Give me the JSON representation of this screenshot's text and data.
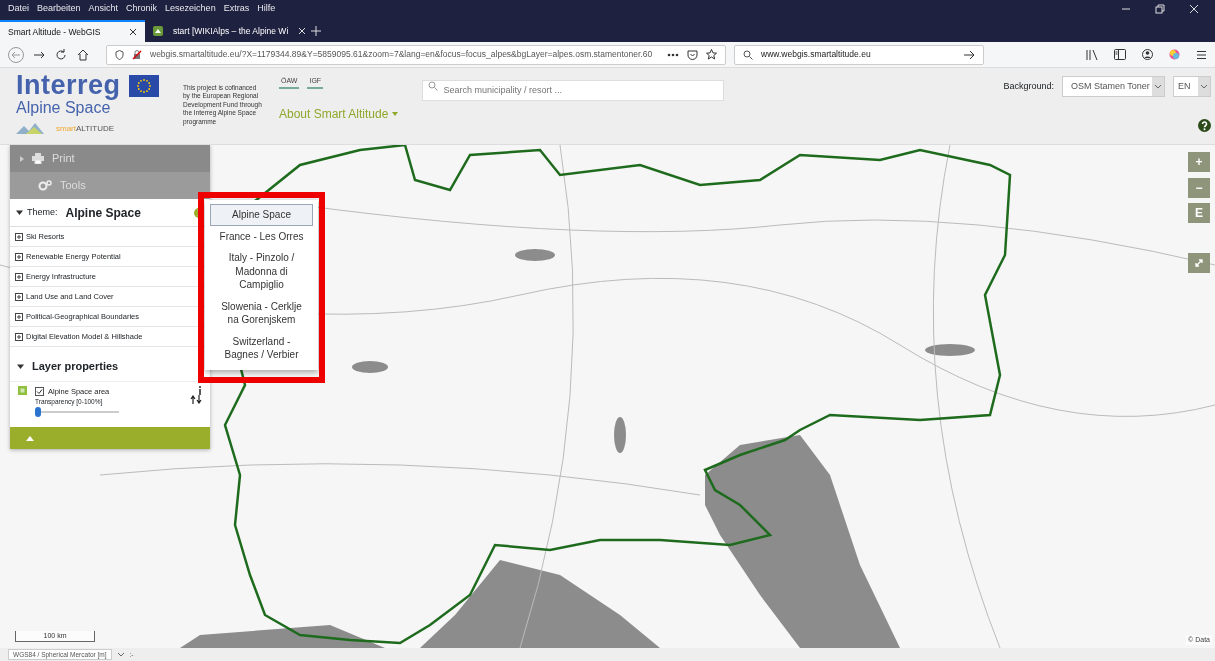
{
  "browser": {
    "menu": [
      "Datei",
      "Bearbeiten",
      "Ansicht",
      "Chronik",
      "Lesezeichen",
      "Extras",
      "Hilfe"
    ],
    "tabs": [
      {
        "label": "Smart Altitude - WebGIS",
        "selected": true
      },
      {
        "label": "start [WIKIAlps – the Alpine Wi",
        "selected": false
      }
    ],
    "url": "webgis.smartaltitude.eu/?X=1179344.89&Y=5859095.61&zoom=7&lang=en&focus=focus_alpes&bgLayer=alpes.osm.stamentoner.60",
    "search_value": "www.webgis.smartaltitude.eu"
  },
  "header": {
    "logo_title": "Interreg",
    "logo_subtitle": "Alpine Space",
    "brand_prefix": "smart",
    "brand_suffix": "ALTITUDE",
    "funding_note": "This project is cofinanced by the European Regional Development Fund through the Interreg Alpine Space programme",
    "partner_logos": [
      "ÖAW",
      "IGF"
    ],
    "about_menu": "About Smart Altitude",
    "search": {
      "placeholder": "Search municipality / resort ..."
    },
    "background_label": "Background:",
    "background_value": "OSM Stamen Toner",
    "language": "EN"
  },
  "sidebar": {
    "panels": [
      "Print",
      "Tools"
    ],
    "theme": {
      "label": "Theme:",
      "name": "Alpine Space",
      "expanded": true
    },
    "layer_groups": [
      "Ski Resorts",
      "Renewable Energy Potential",
      "Energy Infrastructure",
      "Land Use and Land Cover",
      "Political-Geographical Boundaries",
      "Digital Elevation Model & Hillshade"
    ],
    "layer_properties": {
      "title": "Layer properties",
      "expanded": true
    },
    "layers": [
      {
        "name": "Alpine Space area",
        "checked": true,
        "transparency_label": "Transparency [0-100%]",
        "level": 0
      }
    ]
  },
  "theme_menu": {
    "items": [
      {
        "label": "Alpine Space",
        "selected": true
      },
      {
        "label": "France - Les Orres",
        "selected": false
      },
      {
        "label": "Italy - Pinzolo / Madonna di Campiglio",
        "selected": false
      },
      {
        "label": "Slowenia - Cerklje na Gorenjskem",
        "selected": false
      },
      {
        "label": "Switzerland - Bagnes / Verbier",
        "selected": false
      }
    ]
  },
  "map": {
    "controls": [
      "+",
      "−",
      "E"
    ],
    "scale": "100 km",
    "attribution": "© Data"
  },
  "status_bar": {
    "projection": "WGS84 / Spherical Mercator [m]",
    "coordinates": ":-"
  }
}
